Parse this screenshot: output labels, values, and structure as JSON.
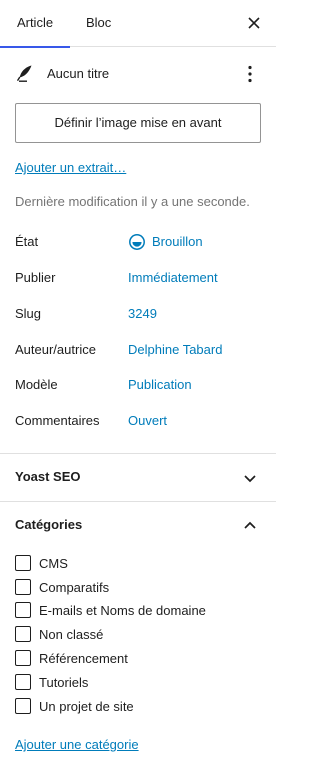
{
  "tabs": {
    "article": "Article",
    "bloc": "Bloc"
  },
  "post": {
    "title": "Aucun titre"
  },
  "featured_image_button": "Définir l’image mise en avant",
  "excerpt_link": "Ajouter un extrait…",
  "last_modified": "Dernière modification il y a une seconde.",
  "meta": [
    {
      "label": "État",
      "value": "Brouillon"
    },
    {
      "label": "Publier",
      "value": "Immédiatement"
    },
    {
      "label": "Slug",
      "value": "3249"
    },
    {
      "label": "Auteur/autrice",
      "value": "Delphine Tabard"
    },
    {
      "label": "Modèle",
      "value": "Publication"
    },
    {
      "label": "Commentaires",
      "value": "Ouvert"
    }
  ],
  "yoast": {
    "title": "Yoast SEO",
    "expanded": false
  },
  "categories": {
    "title": "Catégories",
    "expanded": true,
    "items": [
      {
        "label": "CMS",
        "checked": false
      },
      {
        "label": "Comparatifs",
        "checked": false
      },
      {
        "label": "E-mails et Noms de domaine",
        "checked": false
      },
      {
        "label": "Non classé",
        "checked": false
      },
      {
        "label": "Référencement",
        "checked": false
      },
      {
        "label": "Tutoriels",
        "checked": false
      },
      {
        "label": "Un projet de site",
        "checked": false
      }
    ],
    "add_link": "Ajouter une catégorie"
  },
  "colors": {
    "accent": "#3858e9",
    "link": "#007cba",
    "muted": "#757575",
    "text": "#1e1e1e"
  }
}
